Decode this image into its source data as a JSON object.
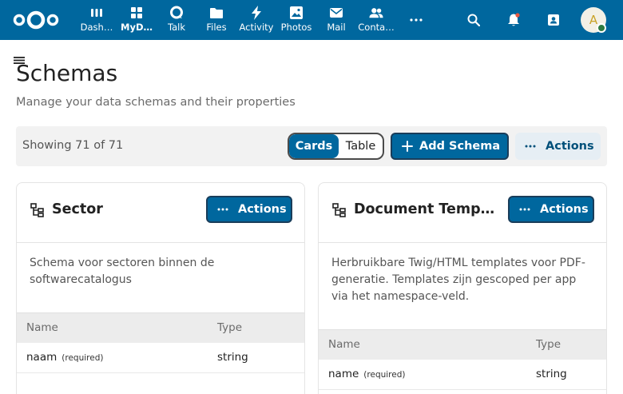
{
  "topbar": {
    "apps": [
      {
        "label": "Dash…",
        "icon": "dashboard-icon",
        "active": false
      },
      {
        "label": "MyD…",
        "icon": "mydash-icon",
        "active": true
      },
      {
        "label": "Talk",
        "icon": "talk-icon",
        "active": false
      },
      {
        "label": "Files",
        "icon": "folder-icon",
        "active": false
      },
      {
        "label": "Activity",
        "icon": "activity-icon",
        "active": false
      },
      {
        "label": "Photos",
        "icon": "image-icon",
        "active": false
      },
      {
        "label": "Mail",
        "icon": "mail-icon",
        "active": false
      },
      {
        "label": "Conta…",
        "icon": "contacts-icon",
        "active": false
      }
    ],
    "avatar_letter": "A",
    "accent": "#00679e"
  },
  "page": {
    "title": "Schemas",
    "subtitle": "Manage your data schemas and their properties"
  },
  "toolbar": {
    "showing": "Showing 71 of 71",
    "view_cards": "Cards",
    "view_table": "Table",
    "add_label": "Add Schema",
    "actions_label": "Actions"
  },
  "cards": [
    {
      "title": "Sector",
      "actions_label": "Actions",
      "description": "Schema voor sectoren binnen de softwarecatalogus",
      "col_name": "Name",
      "col_type": "Type",
      "rows": [
        {
          "name": "naam",
          "required": "(required)",
          "type": "string"
        }
      ]
    },
    {
      "title": "Document Temp…",
      "actions_label": "Actions",
      "description": "Herbruikbare Twig/HTML templates voor PDF-generatie. Templates zijn gescoped per app via het namespace-veld.",
      "col_name": "Name",
      "col_type": "Type",
      "rows": [
        {
          "name": "name",
          "required": "(required)",
          "type": "string"
        }
      ]
    }
  ]
}
